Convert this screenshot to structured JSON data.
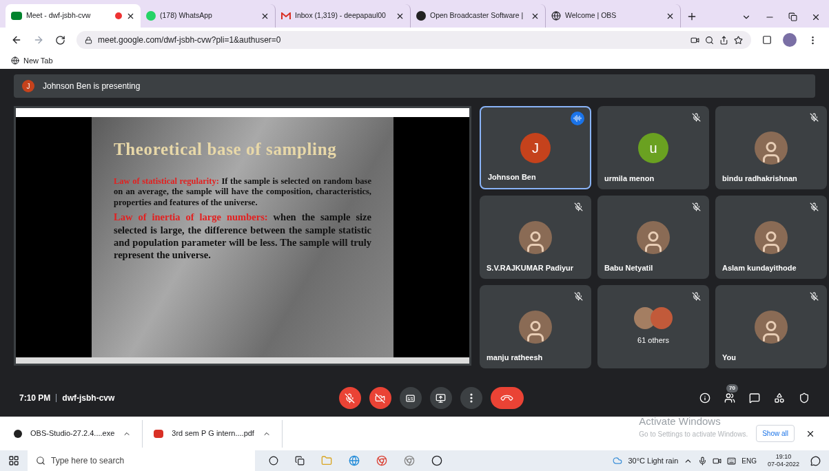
{
  "browser": {
    "tabs": [
      {
        "title": "Meet - dwf-jsbh-cvw",
        "selected": true,
        "recording": true
      },
      {
        "title": "(178) WhatsApp",
        "selected": false,
        "recording": false
      },
      {
        "title": "Inbox (1,319) - deepapaul00",
        "selected": false,
        "recording": false
      },
      {
        "title": "Open Broadcaster Software |",
        "selected": false,
        "recording": false
      },
      {
        "title": "Welcome | OBS",
        "selected": false,
        "recording": false
      }
    ],
    "url": "meet.google.com/dwf-jsbh-cvw?pli=1&authuser=0",
    "bookmarks": [
      "New Tab"
    ]
  },
  "meet": {
    "presenter_banner": {
      "initial": "J",
      "text": "Johnson Ben is presenting"
    },
    "slide": {
      "title": "Theoretical base of sampling",
      "paragraphs": [
        {
          "term": "Law of statistical regularity:",
          "text": "If the sample is selected on random base on an average, the sample will have the composition, characteristics, properties and features of the universe."
        },
        {
          "term": "Law of inertia of large numbers:",
          "text": "when the sample size selected is large, the difference between the sample statistic and population parameter will be less. The sample will truly represent the universe."
        }
      ]
    },
    "participants": [
      {
        "name": "Johnson Ben",
        "kind": "letter",
        "initial": "J",
        "color": "#c5421c",
        "speaking": true
      },
      {
        "name": "urmila menon",
        "kind": "letter",
        "initial": "u",
        "color": "#6aa121",
        "speaking": false
      },
      {
        "name": "bindu radhakrishnan",
        "kind": "photo",
        "speaking": false
      },
      {
        "name": "S.V.RAJKUMAR Padiyur",
        "kind": "photo",
        "speaking": false
      },
      {
        "name": "Babu Netyatil",
        "kind": "photo",
        "speaking": false
      },
      {
        "name": "Aslam kundayithode",
        "kind": "photo",
        "speaking": false
      },
      {
        "name": "manju ratheesh",
        "kind": "photo",
        "speaking": false
      },
      {
        "name": "61 others",
        "kind": "group",
        "speaking": false
      },
      {
        "name": "You",
        "kind": "photo",
        "speaking": false
      }
    ],
    "time": "7:10 PM",
    "meeting_code": "dwf-jsbh-cvw",
    "people_count": "70"
  },
  "downloads": {
    "items": [
      {
        "name": "OBS-Studio-27.2.4....exe"
      },
      {
        "name": "3rd sem P G intern....pdf"
      }
    ],
    "show_all": "Show all"
  },
  "os_notice": {
    "title": "Activate Windows",
    "text": "Go to Settings to activate Windows."
  },
  "taskbar": {
    "search_placeholder": "Type here to search",
    "weather": "30°C  Light rain",
    "language": "ENG",
    "time": "19:10",
    "date": "07-04-2022"
  }
}
